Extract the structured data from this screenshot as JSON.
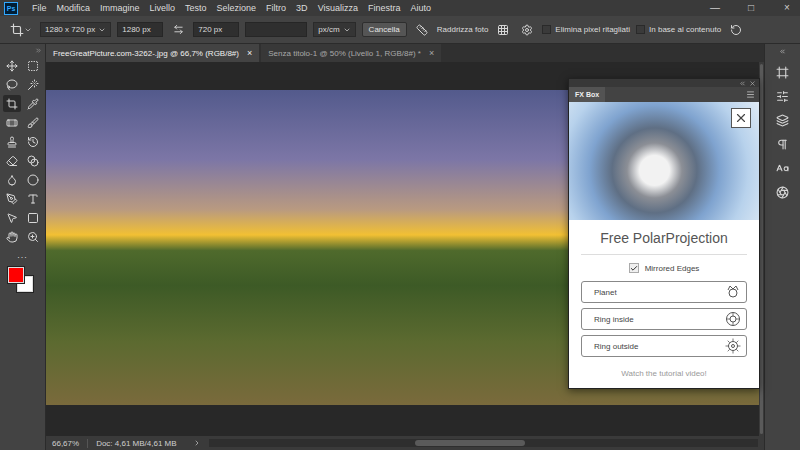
{
  "app": {
    "logo": "Ps"
  },
  "menu": [
    "File",
    "Modifica",
    "Immagine",
    "Livello",
    "Testo",
    "Selezione",
    "Filtro",
    "3D",
    "Visualizza",
    "Finestra",
    "Aiuto"
  ],
  "window_controls": [
    "—",
    "□",
    "×"
  ],
  "options_bar": {
    "preset": "1280 x 720 px",
    "width": "1280 px",
    "height": "720 px",
    "resolution": "",
    "unit": "px/cm",
    "clear_button": "Cancella",
    "straighten": "Raddrizza foto",
    "checkboxes": [
      {
        "label": "Elimina pixel ritagliati",
        "checked": false
      },
      {
        "label": "In base al contenuto",
        "checked": false
      }
    ]
  },
  "tabs": [
    {
      "label": "FreeGreatPicture.com-3262-.jpg @ 66,7% (RGB/8#)",
      "close": "×",
      "selected": true
    },
    {
      "label": "Senza titolo-1 @ 50% (Livello 1, RGB/8#) *",
      "close": "×",
      "selected": false
    }
  ],
  "toolbar": {
    "tools": [
      {
        "selected": false
      },
      {
        "selected": false
      },
      {
        "selected": false
      },
      {
        "selected": false
      },
      {
        "selected": true
      },
      {
        "selected": false
      },
      {
        "selected": false
      },
      {
        "selected": false
      },
      {
        "selected": false
      },
      {
        "selected": false
      },
      {
        "selected": false
      },
      {
        "selected": false
      },
      {
        "selected": false
      },
      {
        "selected": false
      },
      {
        "selected": false
      },
      {
        "selected": false
      },
      {
        "selected": false
      },
      {
        "selected": false
      },
      {
        "selected": false
      },
      {
        "selected": false
      }
    ],
    "more": "...",
    "foreground_color": "#ff0000",
    "background_color": "#ffffff"
  },
  "fx_box": {
    "tab": "FX Box",
    "title": "Free PolarProjection",
    "checkbox": {
      "label": "Mirrored Edges",
      "checked": true
    },
    "buttons": [
      {
        "label": "Planet",
        "kind": "planet"
      },
      {
        "label": "Ring inside",
        "kind": "ring-inside"
      },
      {
        "label": "Ring outside",
        "kind": "ring-outside"
      }
    ],
    "link": "Watch the tutorial video!"
  },
  "status_bar": {
    "zoom": "66,67%",
    "doc": "Doc: 4,61 MB/4,61 MB",
    "horizontal_scroll": {
      "level": 0.47
    }
  }
}
